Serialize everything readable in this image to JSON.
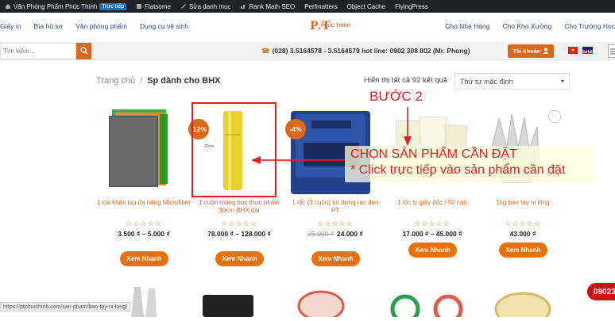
{
  "admin_bar": {
    "site_name": "Văn Phòng Phẩm Phúc Thịnh",
    "live_badge": "Trực tiếp",
    "items": [
      "Flatsome",
      "Sửa danh mục",
      "Rank Math SEO",
      "Perfmatters",
      "Object Cache",
      "FlyingPress"
    ]
  },
  "nav": {
    "left": [
      "Giấy in",
      "Bìa hồ sơ",
      "Văn phòng phẩm",
      "Dụng cụ vệ sinh"
    ],
    "right": [
      "Cho Nhà Hàng",
      "Cho Kho Xưởng",
      "Cho Trường Học"
    ],
    "logo_text": "P.T",
    "logo_name": "PHUC THINH"
  },
  "header": {
    "search_placeholder": "Tìm kiếm...",
    "hotline": "(028) 3.5164578 - 3.5164579 hot line: 0902 308 802 (Mr. Phong)",
    "account_label": "Tài khoản"
  },
  "breadcrumb": {
    "home": "Trang chủ",
    "separator": "/",
    "current": "Sp dành cho BHX"
  },
  "results": {
    "count_text": "Hiển thị tất cả 92 kết quả",
    "sort_selected": "Thứ tự mặc định"
  },
  "products": [
    {
      "name": "1 cái khăn lau đa năng Microfiber",
      "price": "3.500 ₫ – 5.000 ₫",
      "old_price": "",
      "sale": "",
      "button": "Xem Nhanh"
    },
    {
      "name": "1 cuộn màng bọc thực phẩm 30cm BHX dài",
      "price": "78.000 ₫ – 128.000 ₫",
      "old_price": "",
      "sale": "-12%",
      "button": "Xem Nhanh",
      "label": "30cm"
    },
    {
      "name": "1 lốc (3 cuộn) túi đựng rác đen PT",
      "price": "24.000 ₫",
      "old_price": "25.000 ₫",
      "sale": "-4%",
      "button": "Xem Nhanh"
    },
    {
      "name": "1 lốc ly giấy (lốc / 50 cái)",
      "price": "17.000 ₫ – 45.000 ₫",
      "old_price": "",
      "sale": "",
      "button": "Xem Nhanh"
    },
    {
      "name": "1kg bao tay ni lông",
      "price": "43.000 ₫",
      "old_price": "",
      "sale": "",
      "button": "Xem Nhanh"
    }
  ],
  "stars": "☆☆☆☆☆",
  "annotation": {
    "step": "BƯỚC 2",
    "line1": "CHỌN SẢN PHẨM CẦN ĐẶT",
    "line2": "* Click trực tiếp vào sản phẩm cần đặt"
  },
  "status_url": "https://ptphucthinh.com/san-pham/bao-tay-ni-long/",
  "floating_phone": "09023",
  "colors": {
    "accent": "#d9691c",
    "annotation": "#e02020",
    "admin_bar": "#1d2327"
  }
}
